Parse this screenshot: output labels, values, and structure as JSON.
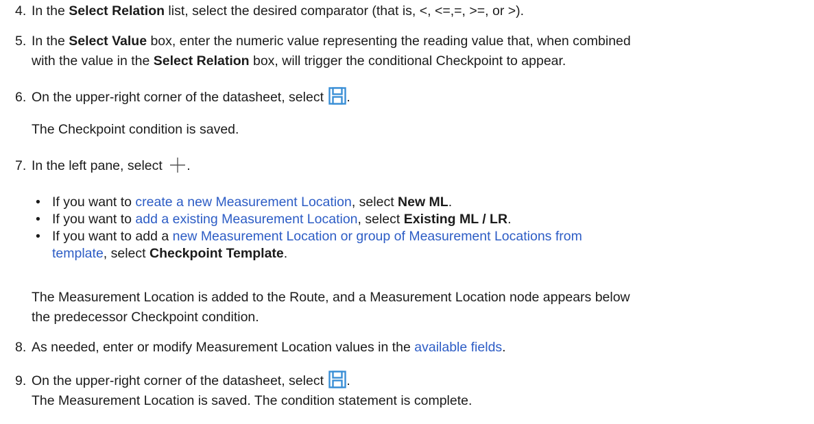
{
  "steps": [
    {
      "num": "4.",
      "a": "In the ",
      "b1": "Select Relation",
      "c": " list, select the desired comparator (that is, <, <=,=, >=, or >)."
    },
    {
      "num": "5.",
      "a": "In the ",
      "b1": "Select Value",
      "c": " box, enter the numeric value representing the reading value that, when combined",
      "line2_a": "with the value in the ",
      "line2_b": "Select Relation",
      "line2_c": " box, will trigger the conditional Checkpoint to appear."
    },
    {
      "num": "6.",
      "a": "On the upper-right corner of the datasheet, select ",
      "end": ".",
      "result": "The Checkpoint condition is saved."
    },
    {
      "num": "7.",
      "a": "In the left pane, select ",
      "end": ".",
      "bullets": [
        {
          "pre": "If you want to ",
          "link": "create a new Measurement Location",
          "mid": ", select ",
          "bold": "New ML",
          "post": "."
        },
        {
          "pre": "If you want to ",
          "link": "add a existing Measurement Location",
          "mid": ", select ",
          "bold": "Existing ML / LR",
          "post": "."
        },
        {
          "pre": "If you want to add a ",
          "link": "new Measurement Location or group of Measurement Locations from",
          "link2": "template",
          "mid": ", select ",
          "bold": "Checkpoint Template",
          "post": "."
        }
      ],
      "result_l1": "The Measurement Location is added to the Route, and a Measurement Location node appears below",
      "result_l2": "the predecessor Checkpoint condition."
    },
    {
      "num": "8.",
      "a": "As needed, enter or modify Measurement Location values in the ",
      "link": "available fields",
      "end": "."
    },
    {
      "num": "9.",
      "a": "On the upper-right corner of the datasheet, select ",
      "end": ".",
      "result": "The Measurement Location is saved. The condition statement is complete."
    }
  ],
  "icons": {
    "save": "save-icon",
    "add": "plus-icon"
  },
  "colors": {
    "text": "#1b1b1b",
    "link": "#2c5cc5",
    "save_icon": "#3a8fd6"
  }
}
